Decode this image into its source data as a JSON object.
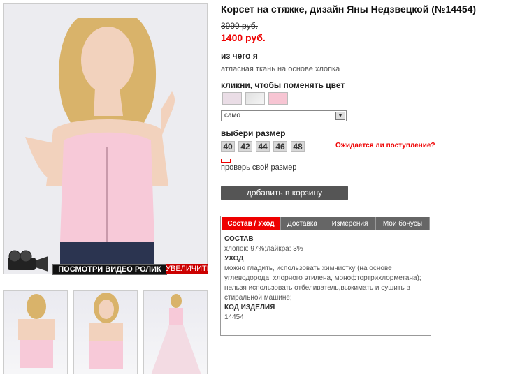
{
  "product": {
    "title": "Корсет на стяжке, дизайн Яны Недзвецкой (№14454)",
    "old_price": "3999 руб.",
    "new_price": "1400 руб.",
    "material_label": "из чего я",
    "material_value": "атласная ткань на основе хлопка",
    "color_label": "кликни, чтобы поменять цвет",
    "color_selected": "само",
    "size_label": "выбери размер",
    "sizes": [
      "40",
      "42",
      "44",
      "46",
      "48"
    ],
    "expected_link": "Ожидается ли поступление?",
    "check_size": "проверь свой размер",
    "add_to_cart": "добавить в корзину"
  },
  "media": {
    "video_label": "ПОСМОТРИ ВИДЕО РОЛИК",
    "zoom_label": "УВЕЛИЧИТЬ"
  },
  "tabs": {
    "items": [
      "Состав / Уход",
      "Доставка",
      "Измерения",
      "Мои бонусы"
    ],
    "content": {
      "composition_h": "СОСТАВ",
      "composition": "хлопок: 97%;лайкра: 3%",
      "care_h": "УХОД",
      "care": "можно гладить, использовать химчистку (на основе углеводорода, хлорного этилена, монофтортрихлорметана); нельзя использовать отбеливатель,выжимать и сушить в стиральной машине;",
      "code_h": "КОД ИЗДЕЛИЯ",
      "code": "14454"
    }
  },
  "colors": {
    "accent": "#e00000",
    "pink": "#f7c5d3",
    "button": "#555555"
  }
}
